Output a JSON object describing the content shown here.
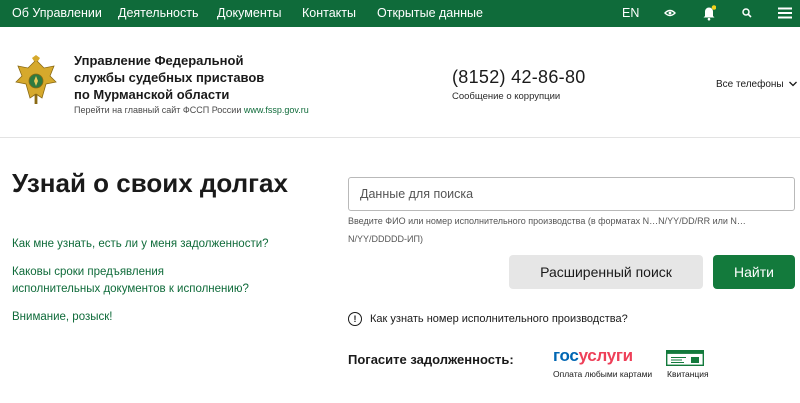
{
  "nav": {
    "items": [
      "Об Управлении",
      "Деятельность",
      "Документы",
      "Контакты",
      "Открытые данные"
    ],
    "lang": "EN",
    "icons": [
      "eye-icon",
      "bell-icon",
      "search-icon",
      "menu-icon"
    ]
  },
  "header": {
    "org_lines": [
      "Управление Федеральной",
      "службы судебных приставов",
      "по Мурманской области"
    ],
    "link_prefix": "Перейти на главный сайт ФССП России",
    "link_url": "www.fssp.gov.ru",
    "phone": "(8152) 42-86-80",
    "phone_sub": "Сообщение о коррупции",
    "all_phones": "Все телефоны"
  },
  "main": {
    "title": "Узнай о своих долгах",
    "links": [
      "Как мне узнать, есть ли у меня задолженности?",
      "Каковы сроки предъявления исполнительных документов к исполнению?",
      "Внимание, розыск!"
    ],
    "search_placeholder": "Данные для поиска",
    "search_hint": "Введите ФИО или номер исполнительного производства (в форматах N…N/YY/DD/RR или N…N/YY/DDDDD-ИП)",
    "advanced_label": "Расширенный поиск",
    "find_label": "Найти",
    "howto_text": "Как узнать номер исполнительного производства?",
    "pay_label": "Погасите задолженность:",
    "gos_a": "гос",
    "gos_b": "услуги",
    "gos_sub": "Оплата любыми картами",
    "kv_label": "Квитанция"
  },
  "colors": {
    "brand_green": "#0f6b3a",
    "button_green": "#137a3c",
    "gos_blue": "#0066b3",
    "gos_red": "#ee3f58"
  }
}
